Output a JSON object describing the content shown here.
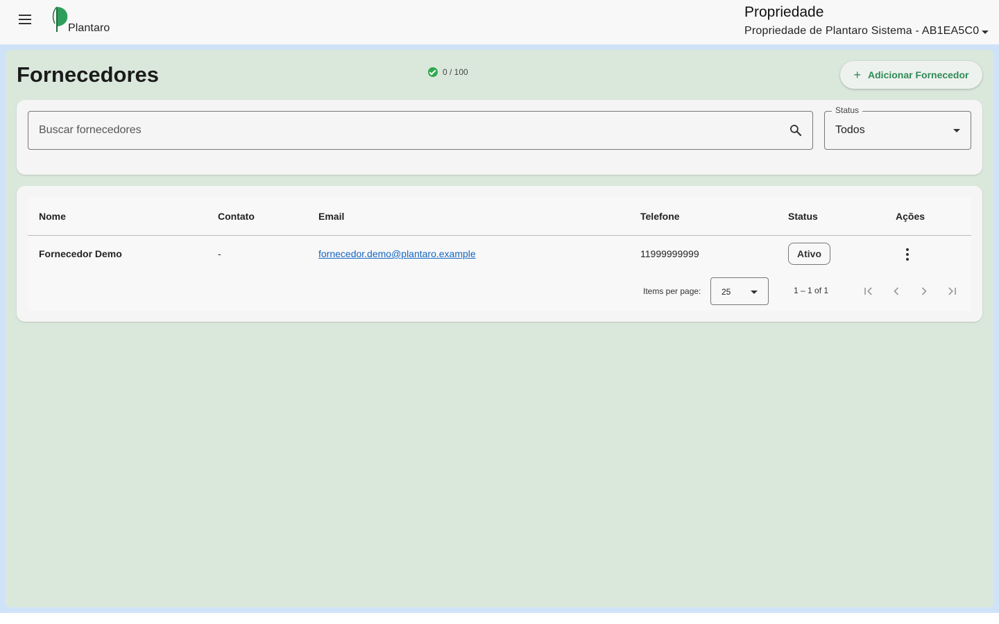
{
  "topbar": {
    "menu_icon": "menu-icon",
    "logo_text": "Plantaro",
    "property_heading": "Propriedade",
    "property_selected": "Propriedade de Plantaro Sistema - AB1EA5C0"
  },
  "page": {
    "title": "Fornecedores",
    "quota": "0 / 100",
    "add_button_label": "Adicionar Fornecedor"
  },
  "filters": {
    "search_placeholder": "Buscar fornecedores",
    "status_label": "Status",
    "status_value": "Todos"
  },
  "table": {
    "columns": [
      "Nome",
      "Contato",
      "Email",
      "Telefone",
      "Status",
      "Ações"
    ],
    "rows": [
      {
        "nome": "Fornecedor Demo",
        "contato": "-",
        "email": "fornecedor.demo@plantaro.example",
        "telefone": "11999999999",
        "status": "Ativo"
      }
    ]
  },
  "paginator": {
    "items_per_page_label": "Items per page:",
    "items_per_page": "25",
    "range_label": "1 – 1 of 1"
  },
  "colors": {
    "accent_green": "#2e8b57",
    "content_bg": "#dae8dc",
    "frame_bg": "#cfe3f8",
    "link_blue": "#1565c0",
    "check_green": "#2fa84f"
  }
}
